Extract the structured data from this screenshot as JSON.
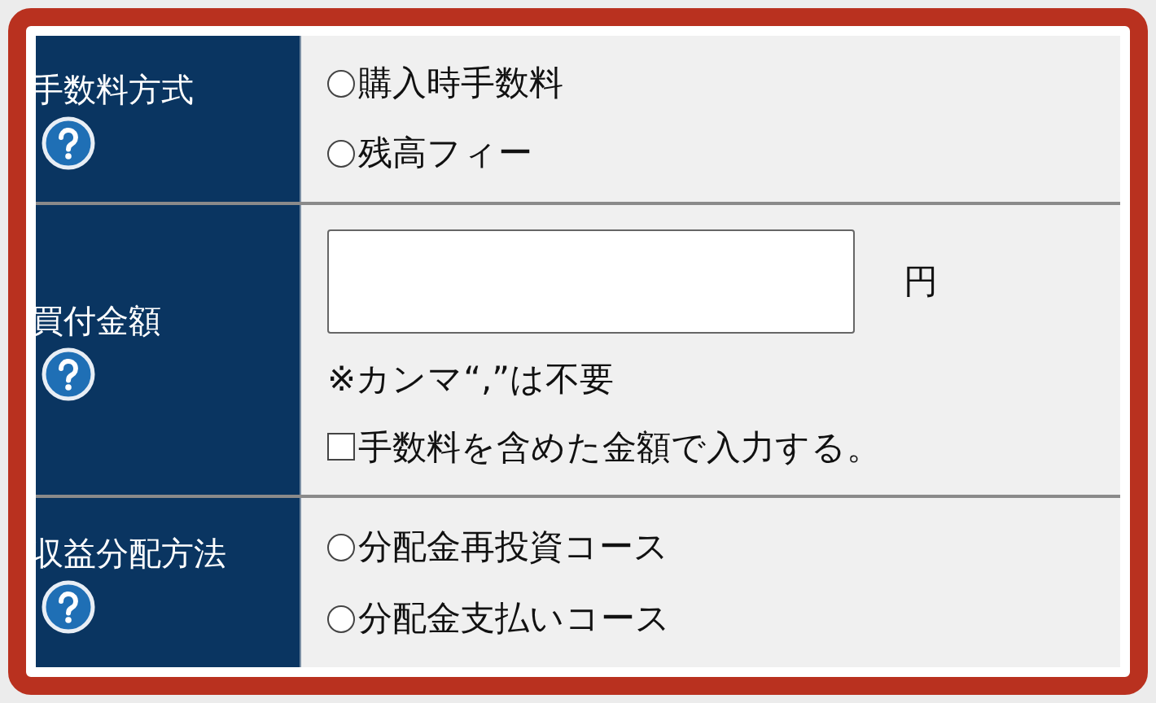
{
  "rows": [
    {
      "label": "手数料方式",
      "help": true,
      "kind": "radios",
      "options": [
        {
          "label": "購入時手数料",
          "selected": false
        },
        {
          "label": "残高フィー",
          "selected": false
        }
      ]
    },
    {
      "label": "買付金額",
      "help": true,
      "kind": "amount",
      "unit": "円",
      "note": "※カンマ“,”は不要",
      "checkbox": {
        "label": "手数料を含めた金額で入力する。",
        "checked": false
      }
    },
    {
      "label": "収益分配方法",
      "help": true,
      "kind": "radios",
      "options": [
        {
          "label": "分配金再投資コース",
          "selected": false
        },
        {
          "label": "分配金支払いコース",
          "selected": false
        }
      ]
    }
  ]
}
